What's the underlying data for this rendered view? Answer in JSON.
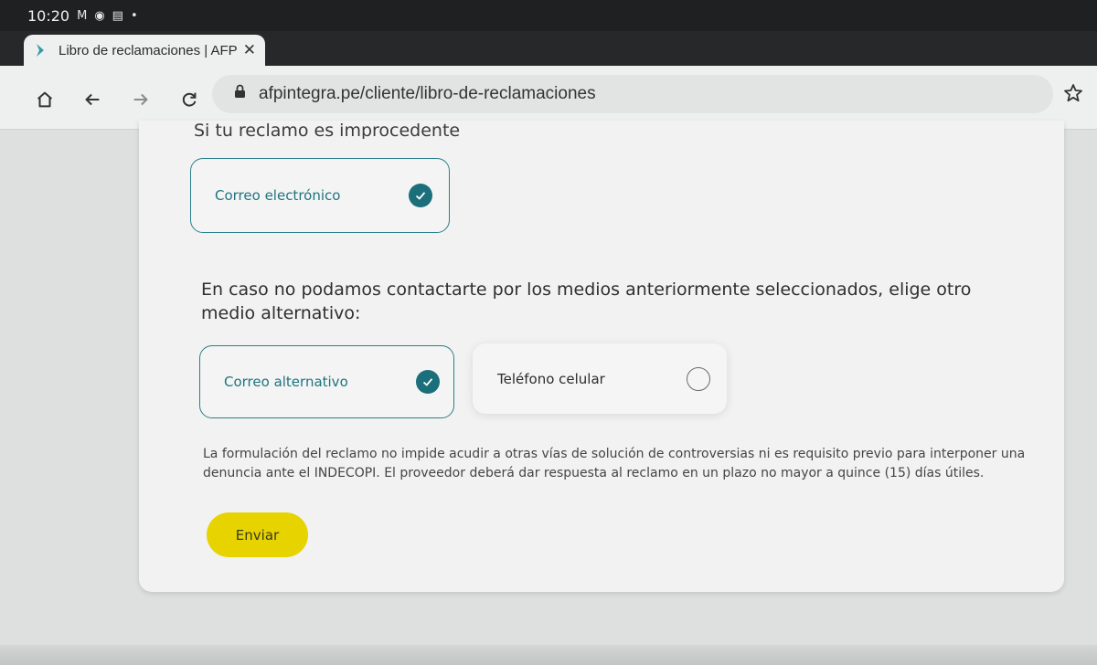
{
  "status_bar": {
    "time": "10:20"
  },
  "browser": {
    "tab_title": "Libro de reclamaciones | AFP",
    "close_glyph": "✕",
    "new_tab_glyph": "+",
    "url": "afpintegra.pe/cliente/libro-de-reclamaciones"
  },
  "form": {
    "section_title": "Si tu reclamo es improcedente",
    "primary_option": {
      "label": "Correo electrónico",
      "selected": true
    },
    "alt_question": "En caso no podamos contactarte por los medios anteriormente seleccionados, elige otro medio alternativo:",
    "alt_options": [
      {
        "label": "Correo alternativo",
        "selected": true
      },
      {
        "label": "Teléfono celular",
        "selected": false
      }
    ],
    "legal_text": "La formulación del reclamo no impide acudir a otras vías de solución de controversias ni es requisito previo para interponer una denuncia ante el INDECOPI. El proveedor deberá dar respuesta al reclamo en un plazo no mayor a quince (15) días útiles.",
    "submit_label": "Enviar"
  },
  "colors": {
    "accent_teal": "#1a6f7a",
    "submit_yellow": "#e6d300"
  },
  "icons": [
    "gmail-icon",
    "chrome-icon",
    "calendar-icon",
    "home-icon",
    "back-arrow-icon",
    "forward-arrow-icon",
    "reload-icon",
    "lock-icon",
    "bookmark-star-icon",
    "check-icon",
    "radio-empty-icon"
  ]
}
